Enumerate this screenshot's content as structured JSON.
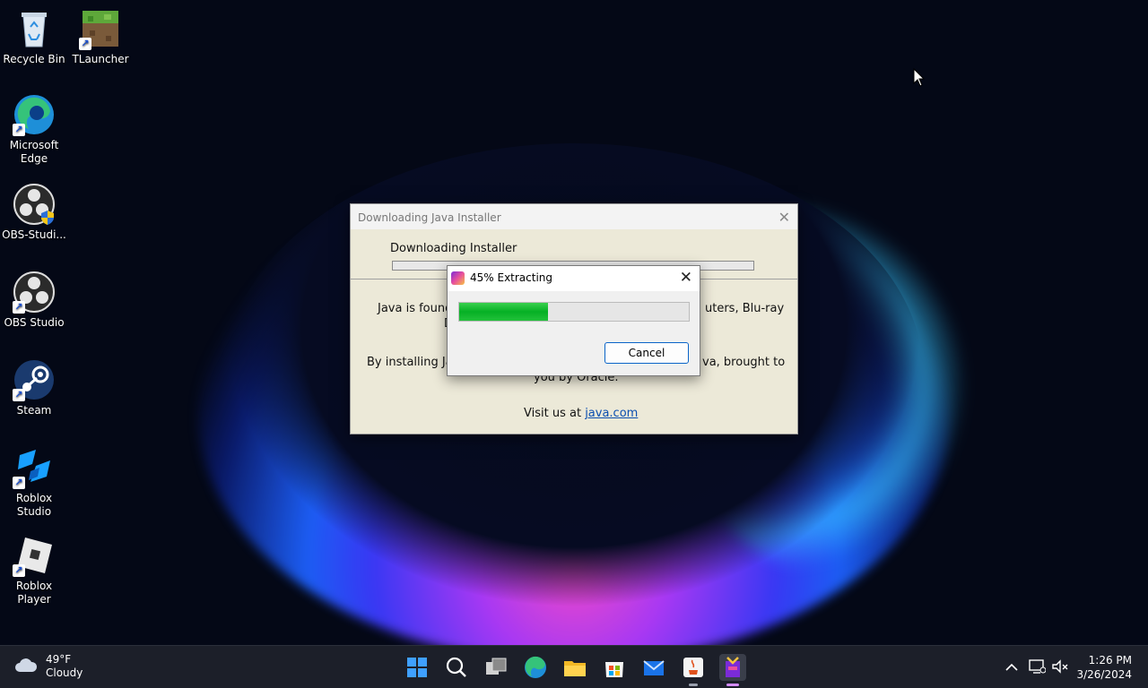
{
  "desktop_icons": [
    {
      "label": "Recycle Bin"
    },
    {
      "label": "TLauncher"
    },
    {
      "label": "Microsoft Edge"
    },
    {
      "label": "OBS-Studi..."
    },
    {
      "label": "OBS Studio"
    },
    {
      "label": "Steam"
    },
    {
      "label": "Roblox Studio"
    },
    {
      "label": "Roblox Player"
    }
  ],
  "installer": {
    "title": "Downloading Java Installer",
    "heading": "Downloading Installer",
    "line1_left": "Java is found",
    "line1_right": "uters, Blu-ray",
    "line1_cont": "D",
    "line2_left": "By installing Jav",
    "line2_right": "va, brought to",
    "line2_cont": "you by Oracle.",
    "visit_prefix": "Visit us at",
    "visit_link": "java.com"
  },
  "extract_dialog": {
    "title": "45% Extracting",
    "progress_percent": 45,
    "cancel_label": "Cancel"
  },
  "taskbar": {
    "weather_temp": "49°F",
    "weather_desc": "Cloudy",
    "time": "1:26 PM",
    "date": "3/26/2024",
    "apps": [
      "start-icon",
      "search-icon",
      "task-view-icon",
      "edge-icon",
      "file-explorer-icon",
      "store-icon",
      "mail-icon",
      "java-icon",
      "installer-icon"
    ]
  },
  "colors": {
    "progress_green": "#06b025",
    "link_blue": "#0b4fb0",
    "taskbar_bg": "#1c1f29"
  }
}
